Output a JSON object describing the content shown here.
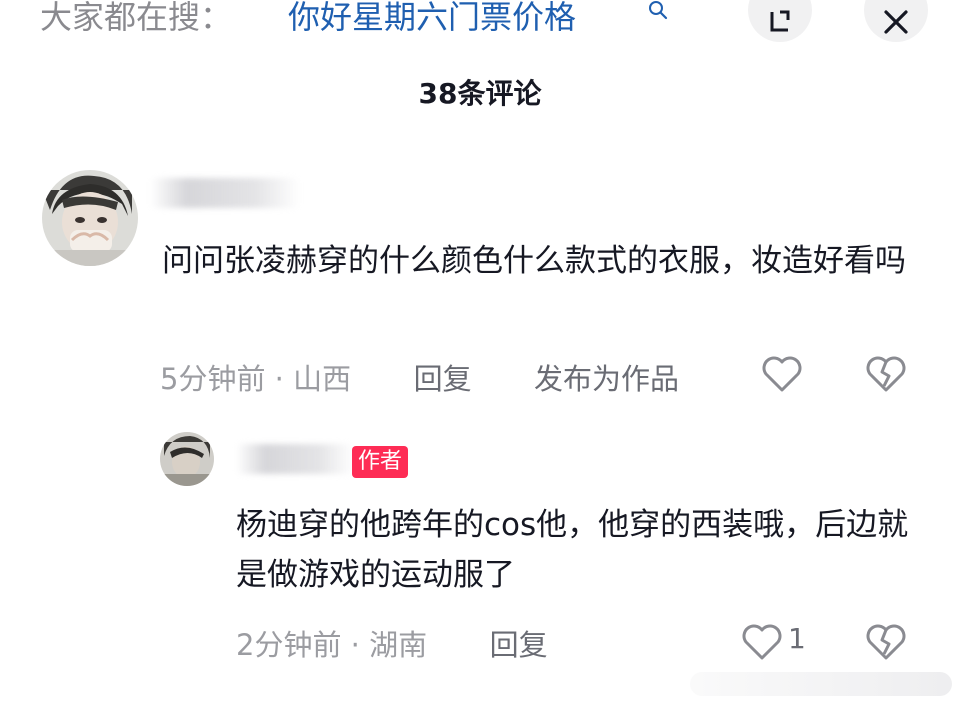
{
  "search": {
    "prefix": "大家都在搜：",
    "query": "你好星期六门票价格"
  },
  "header": {
    "comment_count": "38条评论"
  },
  "comments": [
    {
      "text": "问问张凌赫穿的什么颜色什么款式的衣服，妆造好看吗",
      "time": "5分钟前",
      "location": "山西",
      "reply_label": "回复",
      "publish_label": "发布为作品"
    }
  ],
  "reply": {
    "badge": "作者",
    "text": "杨迪穿的他跨年的cos他，他穿的西装哦，后边就是做游戏的运动服了",
    "time": "2分钟前",
    "location": "湖南",
    "reply_label": "回复",
    "like_count": "1"
  },
  "colors": {
    "accent": "#fe2c55",
    "link": "#1f5fb0",
    "meta": "#9b9ca1"
  },
  "icons": [
    "search-icon",
    "expand-icon",
    "close-icon",
    "heart-icon",
    "broken-heart-icon"
  ]
}
